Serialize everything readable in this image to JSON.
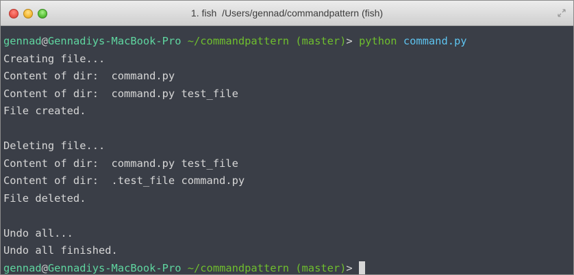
{
  "window": {
    "title": "1. fish  /Users/gennad/commandpattern (fish)"
  },
  "terminal": {
    "prompt": {
      "user": "gennad",
      "at": "@",
      "host": "Gennadiys-MacBook-Pro",
      "path": " ~/commandpattern (master)",
      "symbol": "> "
    },
    "command": {
      "program": "python",
      "space": " ",
      "argument": "command.py"
    },
    "output": [
      "Creating file...",
      "Content of dir:  command.py",
      "Content of dir:  command.py test_file",
      "File created.",
      "",
      "Deleting file...",
      "Content of dir:  command.py test_file",
      "Content of dir:  .test_file command.py",
      "File deleted.",
      "",
      "Undo all...",
      "Undo all finished."
    ]
  },
  "colors": {
    "background": "#3a3e47",
    "text": "#d7d7d7",
    "user_host": "#5fd6a0",
    "path": "#6fbf2e",
    "argument": "#5ec4f0"
  }
}
